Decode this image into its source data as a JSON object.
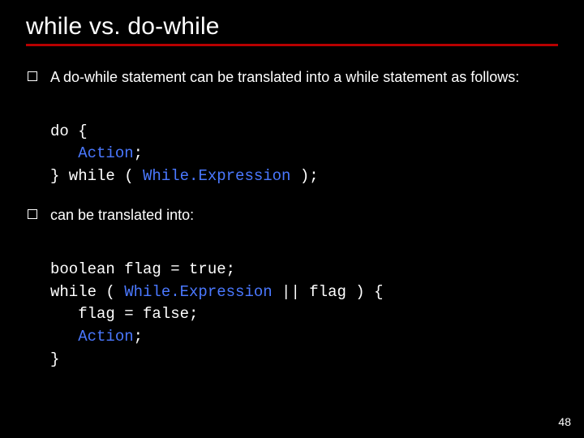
{
  "title": "while vs. do-while",
  "bullets": {
    "b1": "A do-while statement can be translated into a while statement as follows:",
    "b2": "can be translated into:"
  },
  "code1": {
    "l1": "do {",
    "l2_indent": "   ",
    "l2a": "Action",
    "l2b": ";",
    "l3a": "} while ( ",
    "l3b": "While.Expression",
    "l3c": " );"
  },
  "code2": {
    "l1": "boolean flag = true;",
    "l2a": "while ( ",
    "l2b": "While.Expression",
    "l2c": " || flag ) {",
    "l3": "   flag = false;",
    "l4_indent": "   ",
    "l4a": "Action",
    "l4b": ";",
    "l5": "}"
  },
  "slide_number": "48"
}
